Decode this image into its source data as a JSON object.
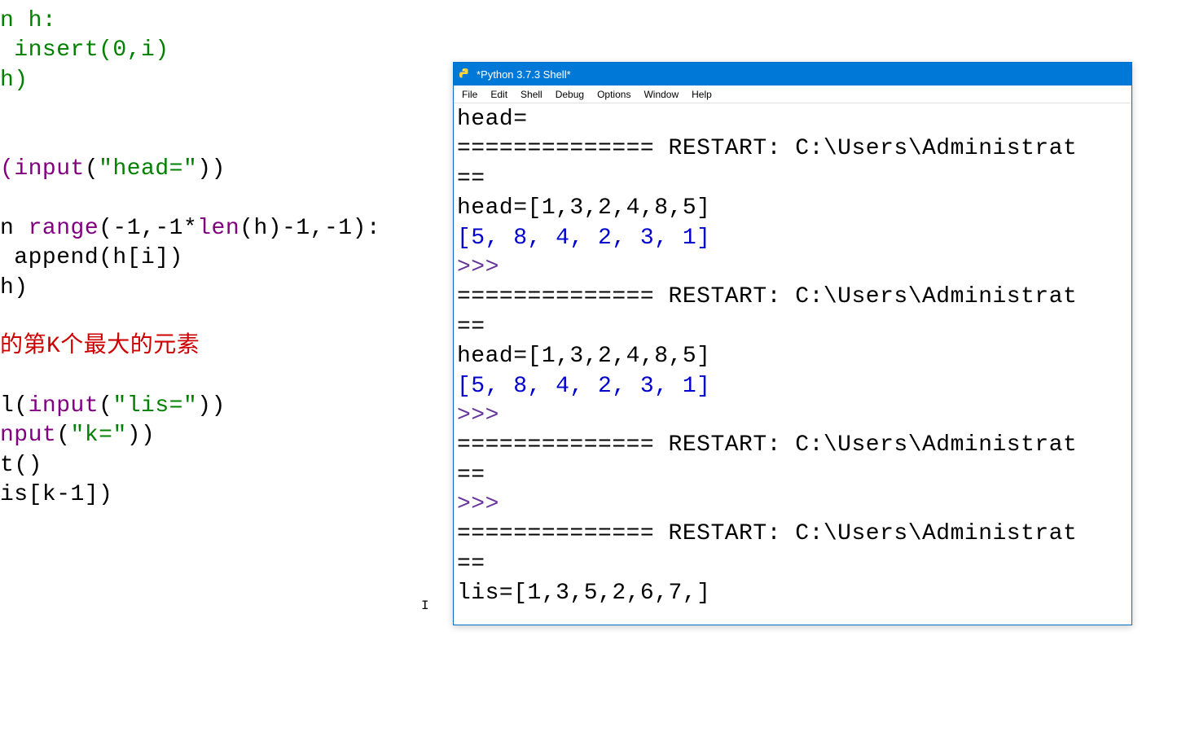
{
  "editor": {
    "lines": [
      {
        "segments": [
          {
            "text": "n h:",
            "cls": "g"
          }
        ]
      },
      {
        "segments": [
          {
            "text": " insert(0,i)",
            "cls": "g"
          }
        ]
      },
      {
        "segments": [
          {
            "text": "h)",
            "cls": "g"
          }
        ]
      },
      {
        "segments": []
      },
      {
        "segments": []
      },
      {
        "segments": [
          {
            "text": "(",
            "cls": "p"
          },
          {
            "text": "input",
            "cls": "p"
          },
          {
            "text": "(",
            "cls": "k"
          },
          {
            "text": "\"head=\"",
            "cls": "g"
          },
          {
            "text": "))",
            "cls": "k"
          }
        ]
      },
      {
        "segments": []
      },
      {
        "segments": [
          {
            "text": "n ",
            "cls": "k"
          },
          {
            "text": "range",
            "cls": "p"
          },
          {
            "text": "(-1,-1*",
            "cls": "k"
          },
          {
            "text": "len",
            "cls": "p"
          },
          {
            "text": "(h)-1,-1):",
            "cls": "k"
          }
        ]
      },
      {
        "segments": [
          {
            "text": " append(h[i])",
            "cls": "k"
          }
        ]
      },
      {
        "segments": [
          {
            "text": "h)",
            "cls": "k"
          }
        ]
      },
      {
        "segments": []
      },
      {
        "segments": [
          {
            "text": "的第K个最大的元素",
            "cls": "r"
          }
        ]
      },
      {
        "segments": []
      },
      {
        "segments": [
          {
            "text": "l(",
            "cls": "k"
          },
          {
            "text": "input",
            "cls": "p"
          },
          {
            "text": "(",
            "cls": "k"
          },
          {
            "text": "\"lis=\"",
            "cls": "g"
          },
          {
            "text": "))",
            "cls": "k"
          }
        ]
      },
      {
        "segments": [
          {
            "text": "nput",
            "cls": "p"
          },
          {
            "text": "(",
            "cls": "k"
          },
          {
            "text": "\"k=\"",
            "cls": "g"
          },
          {
            "text": "))",
            "cls": "k"
          }
        ]
      },
      {
        "segments": [
          {
            "text": "t()",
            "cls": "k"
          }
        ]
      },
      {
        "segments": [
          {
            "text": "is[k-1])",
            "cls": "k"
          }
        ]
      }
    ]
  },
  "shell": {
    "title": "*Python 3.7.3 Shell*",
    "menus": [
      "File",
      "Edit",
      "Shell",
      "Debug",
      "Options",
      "Window",
      "Help"
    ],
    "lines": [
      {
        "segments": [
          {
            "text": "head=",
            "cls": "k"
          }
        ]
      },
      {
        "segments": [
          {
            "text": "============== RESTART: C:\\Users\\Administrat",
            "cls": "k"
          }
        ]
      },
      {
        "segments": [
          {
            "text": "== ",
            "cls": "k"
          }
        ]
      },
      {
        "segments": [
          {
            "text": "head=[1,3,2,4,8,5]",
            "cls": "k"
          }
        ]
      },
      {
        "segments": [
          {
            "text": "[5, 8, 4, 2, 3, 1]",
            "cls": "b"
          }
        ]
      },
      {
        "segments": [
          {
            "text": ">>> ",
            "cls": "pr"
          }
        ]
      },
      {
        "segments": [
          {
            "text": "============== RESTART: C:\\Users\\Administrat",
            "cls": "k"
          }
        ]
      },
      {
        "segments": [
          {
            "text": "== ",
            "cls": "k"
          }
        ]
      },
      {
        "segments": [
          {
            "text": "head=[1,3,2,4,8,5]",
            "cls": "k"
          }
        ]
      },
      {
        "segments": [
          {
            "text": "[5, 8, 4, 2, 3, 1]",
            "cls": "b"
          }
        ]
      },
      {
        "segments": [
          {
            "text": ">>> ",
            "cls": "pr"
          }
        ]
      },
      {
        "segments": [
          {
            "text": "============== RESTART: C:\\Users\\Administrat",
            "cls": "k"
          }
        ]
      },
      {
        "segments": [
          {
            "text": "== ",
            "cls": "k"
          }
        ]
      },
      {
        "segments": [
          {
            "text": ">>> ",
            "cls": "pr"
          }
        ]
      },
      {
        "segments": [
          {
            "text": "============== RESTART: C:\\Users\\Administrat",
            "cls": "k"
          }
        ]
      },
      {
        "segments": [
          {
            "text": "== ",
            "cls": "k"
          }
        ]
      },
      {
        "segments": [
          {
            "text": "lis=[1,3,5,2,6,7,]",
            "cls": "k"
          }
        ]
      }
    ]
  }
}
